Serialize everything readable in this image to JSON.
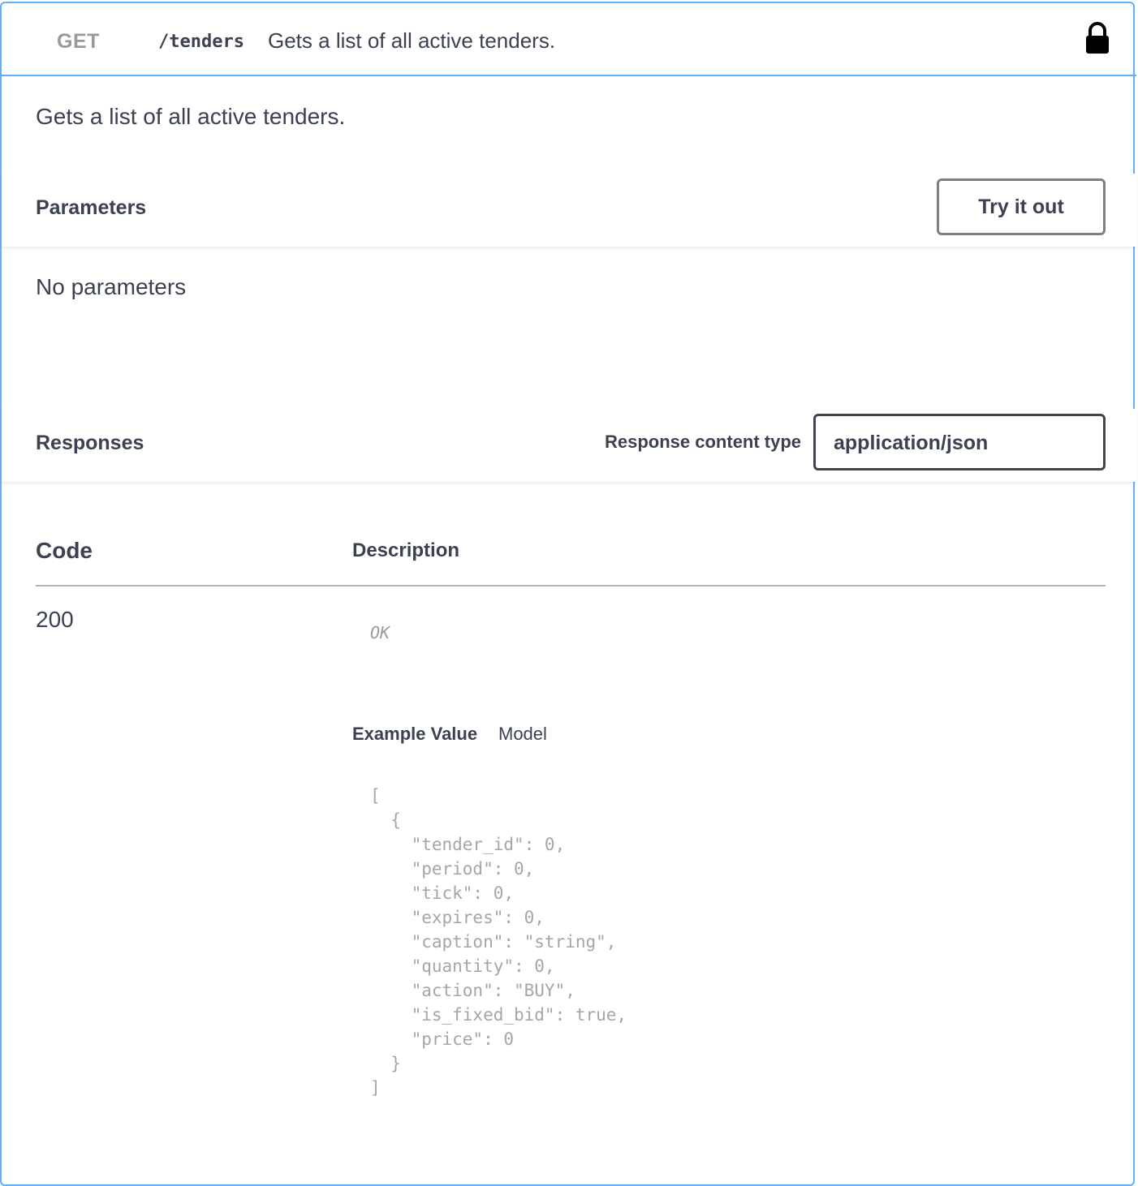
{
  "operation": {
    "method": "GET",
    "path": "/tenders",
    "summary": "Gets a list of all active tenders.",
    "lock_icon": "lock-icon",
    "description": "Gets a list of all active tenders."
  },
  "parameters": {
    "title": "Parameters",
    "try_label": "Try it out",
    "empty_text": "No parameters"
  },
  "responses": {
    "title": "Responses",
    "content_type_label": "Response content type",
    "content_type_value": "application/json",
    "columns": {
      "code": "Code",
      "description": "Description"
    },
    "rows": [
      {
        "code": "200",
        "description": "OK",
        "tabs": {
          "example": "Example Value",
          "model": "Model"
        },
        "example": "[\n  {\n    \"tender_id\": 0,\n    \"period\": 0,\n    \"tick\": 0,\n    \"expires\": 0,\n    \"caption\": \"string\",\n    \"quantity\": 0,\n    \"action\": \"BUY\",\n    \"is_fixed_bid\": true,\n    \"price\": 0\n  }\n]"
      }
    ]
  },
  "colors": {
    "accent": "#61affe",
    "text": "#3b4151",
    "muted": "#9a9a9a"
  }
}
